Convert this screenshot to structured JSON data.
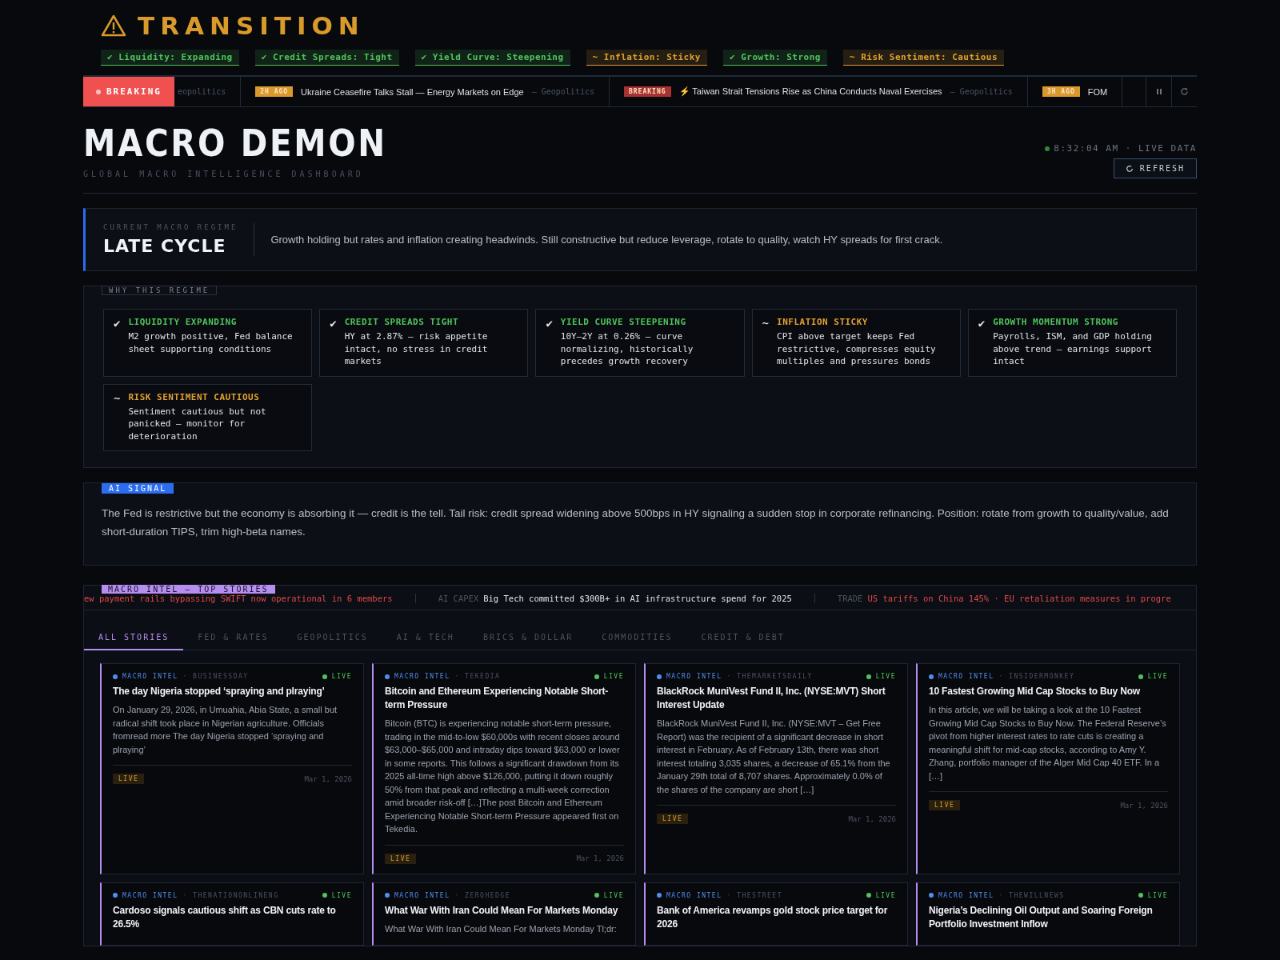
{
  "regime_banner": {
    "title": "TRANSITION",
    "signals": [
      {
        "label": "✔ Liquidity: Expanding",
        "color": "#4ec45a"
      },
      {
        "label": "✔ Credit Spreads: Tight",
        "color": "#4ec45a"
      },
      {
        "label": "✔ Yield Curve: Steepening",
        "color": "#4ec45a"
      },
      {
        "label": "~ Inflation: Sticky",
        "color": "#e0a030"
      },
      {
        "label": "✔ Growth: Strong",
        "color": "#4ec45a"
      },
      {
        "label": "~ Risk Sentiment: Cautious",
        "color": "#e0a030"
      }
    ]
  },
  "breaking_bar": {
    "label": "BREAKING",
    "items": [
      {
        "kind": "fragment",
        "category": "eopolitics"
      },
      {
        "kind": "headline",
        "badge": "2H AGO",
        "color": "#d99a2b",
        "headline": "Ukraine Ceasefire Talks Stall — Energy Markets on Edge",
        "category": "— Geopolitics"
      },
      {
        "kind": "headline",
        "badge": "BREAKING",
        "color": "#a83232",
        "headline": "⚡ Taiwan Strait Tensions Rise as China Conducts Naval Exercises",
        "category": "— Geopolitics"
      },
      {
        "kind": "headline",
        "badge": "3H AGO",
        "color": "#d99a2b",
        "headline": "FOM"
      }
    ]
  },
  "header": {
    "title": "MACRO DEMON",
    "subtitle": "GLOBAL MACRO INTELLIGENCE DASHBOARD",
    "status": "8:32:04 AM · LIVE DATA",
    "live": true,
    "refresh_button": "REFRESH"
  },
  "current_regime": {
    "label": "CURRENT MACRO REGIME",
    "name": "LATE CYCLE",
    "summary": "Growth holding but rates and inflation creating headwinds. Still constructive but reduce leverage, rotate to quality, watch HY spreads for first crack."
  },
  "why_regime": {
    "title": "WHY THIS REGIME",
    "factors": [
      {
        "color": "#4ec45a",
        "mark": "✔",
        "title": "LIQUIDITY EXPANDING",
        "text": "M2 growth positive, Fed balance sheet supporting conditions"
      },
      {
        "color": "#4ec45a",
        "mark": "✔",
        "title": "CREDIT SPREADS TIGHT",
        "text": "HY at 2.87% — risk appetite intact, no stress in credit markets"
      },
      {
        "color": "#4ec45a",
        "mark": "✔",
        "title": "YIELD CURVE STEEPENING",
        "text": "10Y–2Y at 0.26% — curve normalizing, historically precedes growth recovery"
      },
      {
        "color": "#e0a030",
        "mark": "~",
        "title": "INFLATION STICKY",
        "text": "CPI above target keeps Fed restrictive, compresses equity multiples and pressures bonds"
      },
      {
        "color": "#4ec45a",
        "mark": "✔",
        "title": "GROWTH MOMENTUM STRONG",
        "text": "Payrolls, ISM, and GDP holding above trend — earnings support intact"
      },
      {
        "color": "#e0a030",
        "mark": "~",
        "title": "RISK SENTIMENT CAUTIOUS",
        "text": "Sentiment cautious but not panicked — monitor for deterioration"
      }
    ]
  },
  "ai_signal": {
    "label": "AI SIGNAL",
    "text": "The Fed is restrictive but the economy is absorbing it — credit is the tell. Tail risk: credit spread widening above 500bps in HY signaling a sudden stop in corporate refinancing. Position: rotate from growth to quality/value, add short-duration TIPS, trim high-beta names."
  },
  "top_stories": {
    "label": "MACRO INTEL — TOP STORIES",
    "ticker": [
      {
        "text": "ew payment rails bypassing SWIFT now operational in 6 members",
        "color": "#e04848"
      },
      {
        "tag": "AI CAPEX",
        "text": "Big Tech committed $300B+ in AI infrastructure spend for 2025",
        "color": "#dfe3e8"
      },
      {
        "tag": "TRADE",
        "text": "US tariffs on China 145% · EU retaliation measures in progre",
        "color": "#e04848"
      }
    ],
    "tabs": [
      {
        "label": "ALL STORIES",
        "selected": true
      },
      {
        "label": "FED & RATES",
        "selected": false
      },
      {
        "label": "GEOPOLITICS",
        "selected": false
      },
      {
        "label": "AI & TECH",
        "selected": false
      },
      {
        "label": "BRICS & DOLLAR",
        "selected": false
      },
      {
        "label": "COMMODITIES",
        "selected": false
      },
      {
        "label": "CREDIT & DEBT",
        "selected": false
      }
    ],
    "stories": [
      {
        "feed": "MACRO INTEL",
        "source": "· BUSINESSDAY",
        "status": "LIVE",
        "title": "The day Nigeria stopped ‘spraying and plraying’",
        "excerpt": "On January 29, 2026, in Umuahia, Abia State, a small but radical shift took place in Nigerian agriculture. Officials fromread more The day Nigeria stopped ‘spraying and plraying’",
        "badge": "LIVE",
        "date": "Mar 1, 2026"
      },
      {
        "feed": "MACRO INTEL",
        "source": "· TEKEDIA",
        "status": "LIVE",
        "title": "Bitcoin and Ethereum Experiencing Notable Short-term Pressure",
        "excerpt": "Bitcoin (BTC) is experiencing notable short-term pressure, trading in the mid-to-low $60,000s with recent closes around $63,000–$65,000 and intraday dips toward $63,000 or lower in some reports. This follows a significant drawdown from its 2025 all-time high above $126,000, putting it down roughly 50% from that peak and reflecting a multi-week correction amid broader risk-off […]The post Bitcoin and Ethereum Experiencing Notable Short-term Pressure appeared first on Tekedia.",
        "badge": "LIVE",
        "date": "Mar 1, 2026"
      },
      {
        "feed": "MACRO INTEL",
        "source": "· THEMARKETSDAILY",
        "status": "LIVE",
        "title": "BlackRock MuniVest Fund II, Inc. (NYSE:MVT) Short Interest Update",
        "excerpt": "BlackRock MuniVest Fund II, Inc. (NYSE:MVT – Get Free Report) was the recipient of a significant decrease in short interest in February. As of February 13th, there was short interest totaling 3,035 shares, a decrease of 65.1% from the January 29th total of 8,707 shares. Approximately 0.0% of the shares of the company are short […]",
        "badge": "LIVE",
        "date": "Mar 1, 2026"
      },
      {
        "feed": "MACRO INTEL",
        "source": "· INSIDERMONKEY",
        "status": "LIVE",
        "title": "10 Fastest Growing Mid Cap Stocks to Buy Now",
        "excerpt": "In this article, we will be taking a look at the 10 Fastest Growing Mid Cap Stocks to Buy Now. The Federal Reserve’s pivot from higher interest rates to rate cuts is creating a meaningful shift for mid-cap stocks, according to Amy Y. Zhang, portfolio manager of the Alger Mid Cap 40 ETF. In a […]",
        "badge": "LIVE",
        "date": "Mar 1, 2026"
      },
      {
        "feed": "MACRO INTEL",
        "source": "· THENATIONONLINENG",
        "status": "LIVE",
        "title": "Cardoso signals cautious shift as CBN cuts rate to 26.5%"
      },
      {
        "feed": "MACRO INTEL",
        "source": "· ZEROHEDGE",
        "status": "LIVE",
        "title": "What War With Iran Could Mean For Markets Monday",
        "excerpt": "What War With Iran Could Mean For Markets Monday Tl;dr:"
      },
      {
        "feed": "MACRO INTEL",
        "source": "· THESTREET",
        "status": "LIVE",
        "title": "Bank of America revamps gold stock price target for 2026"
      },
      {
        "feed": "MACRO INTEL",
        "source": "· THEWILLNEWS",
        "status": "LIVE",
        "title": "Nigeria’s Declining Oil Output and Soaring Foreign Portfolio Investment Inflow"
      }
    ]
  }
}
